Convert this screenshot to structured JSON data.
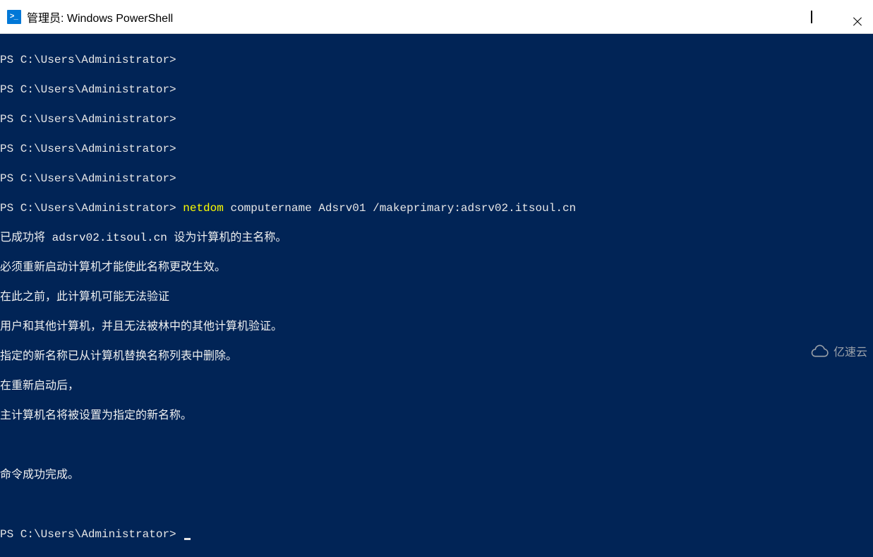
{
  "window": {
    "title": "管理员: Windows PowerShell",
    "icon_label": ">_"
  },
  "terminal": {
    "prompts": [
      "PS C:\\Users\\Administrator>",
      "PS C:\\Users\\Administrator>",
      "PS C:\\Users\\Administrator>",
      "PS C:\\Users\\Administrator>",
      "PS C:\\Users\\Administrator>"
    ],
    "command_prompt": "PS C:\\Users\\Administrator> ",
    "command_keyword": "netdom",
    "command_args": " computername Adsrv01 /makeprimary:adsrv02.itsoul.cn",
    "output": [
      "已成功将 adsrv02.itsoul.cn 设为计算机的主名称。",
      "必须重新启动计算机才能使此名称更改生效。",
      "在此之前，此计算机可能无法验证",
      "用户和其他计算机，并且无法被林中的其他计算机验证。",
      "指定的新名称已从计算机替换名称列表中删除。",
      "在重新启动后，",
      "主计算机名将被设置为指定的新名称。"
    ],
    "success": "命令成功完成。",
    "final_prompt": "PS C:\\Users\\Administrator> "
  },
  "watermark": {
    "text": "亿速云"
  }
}
